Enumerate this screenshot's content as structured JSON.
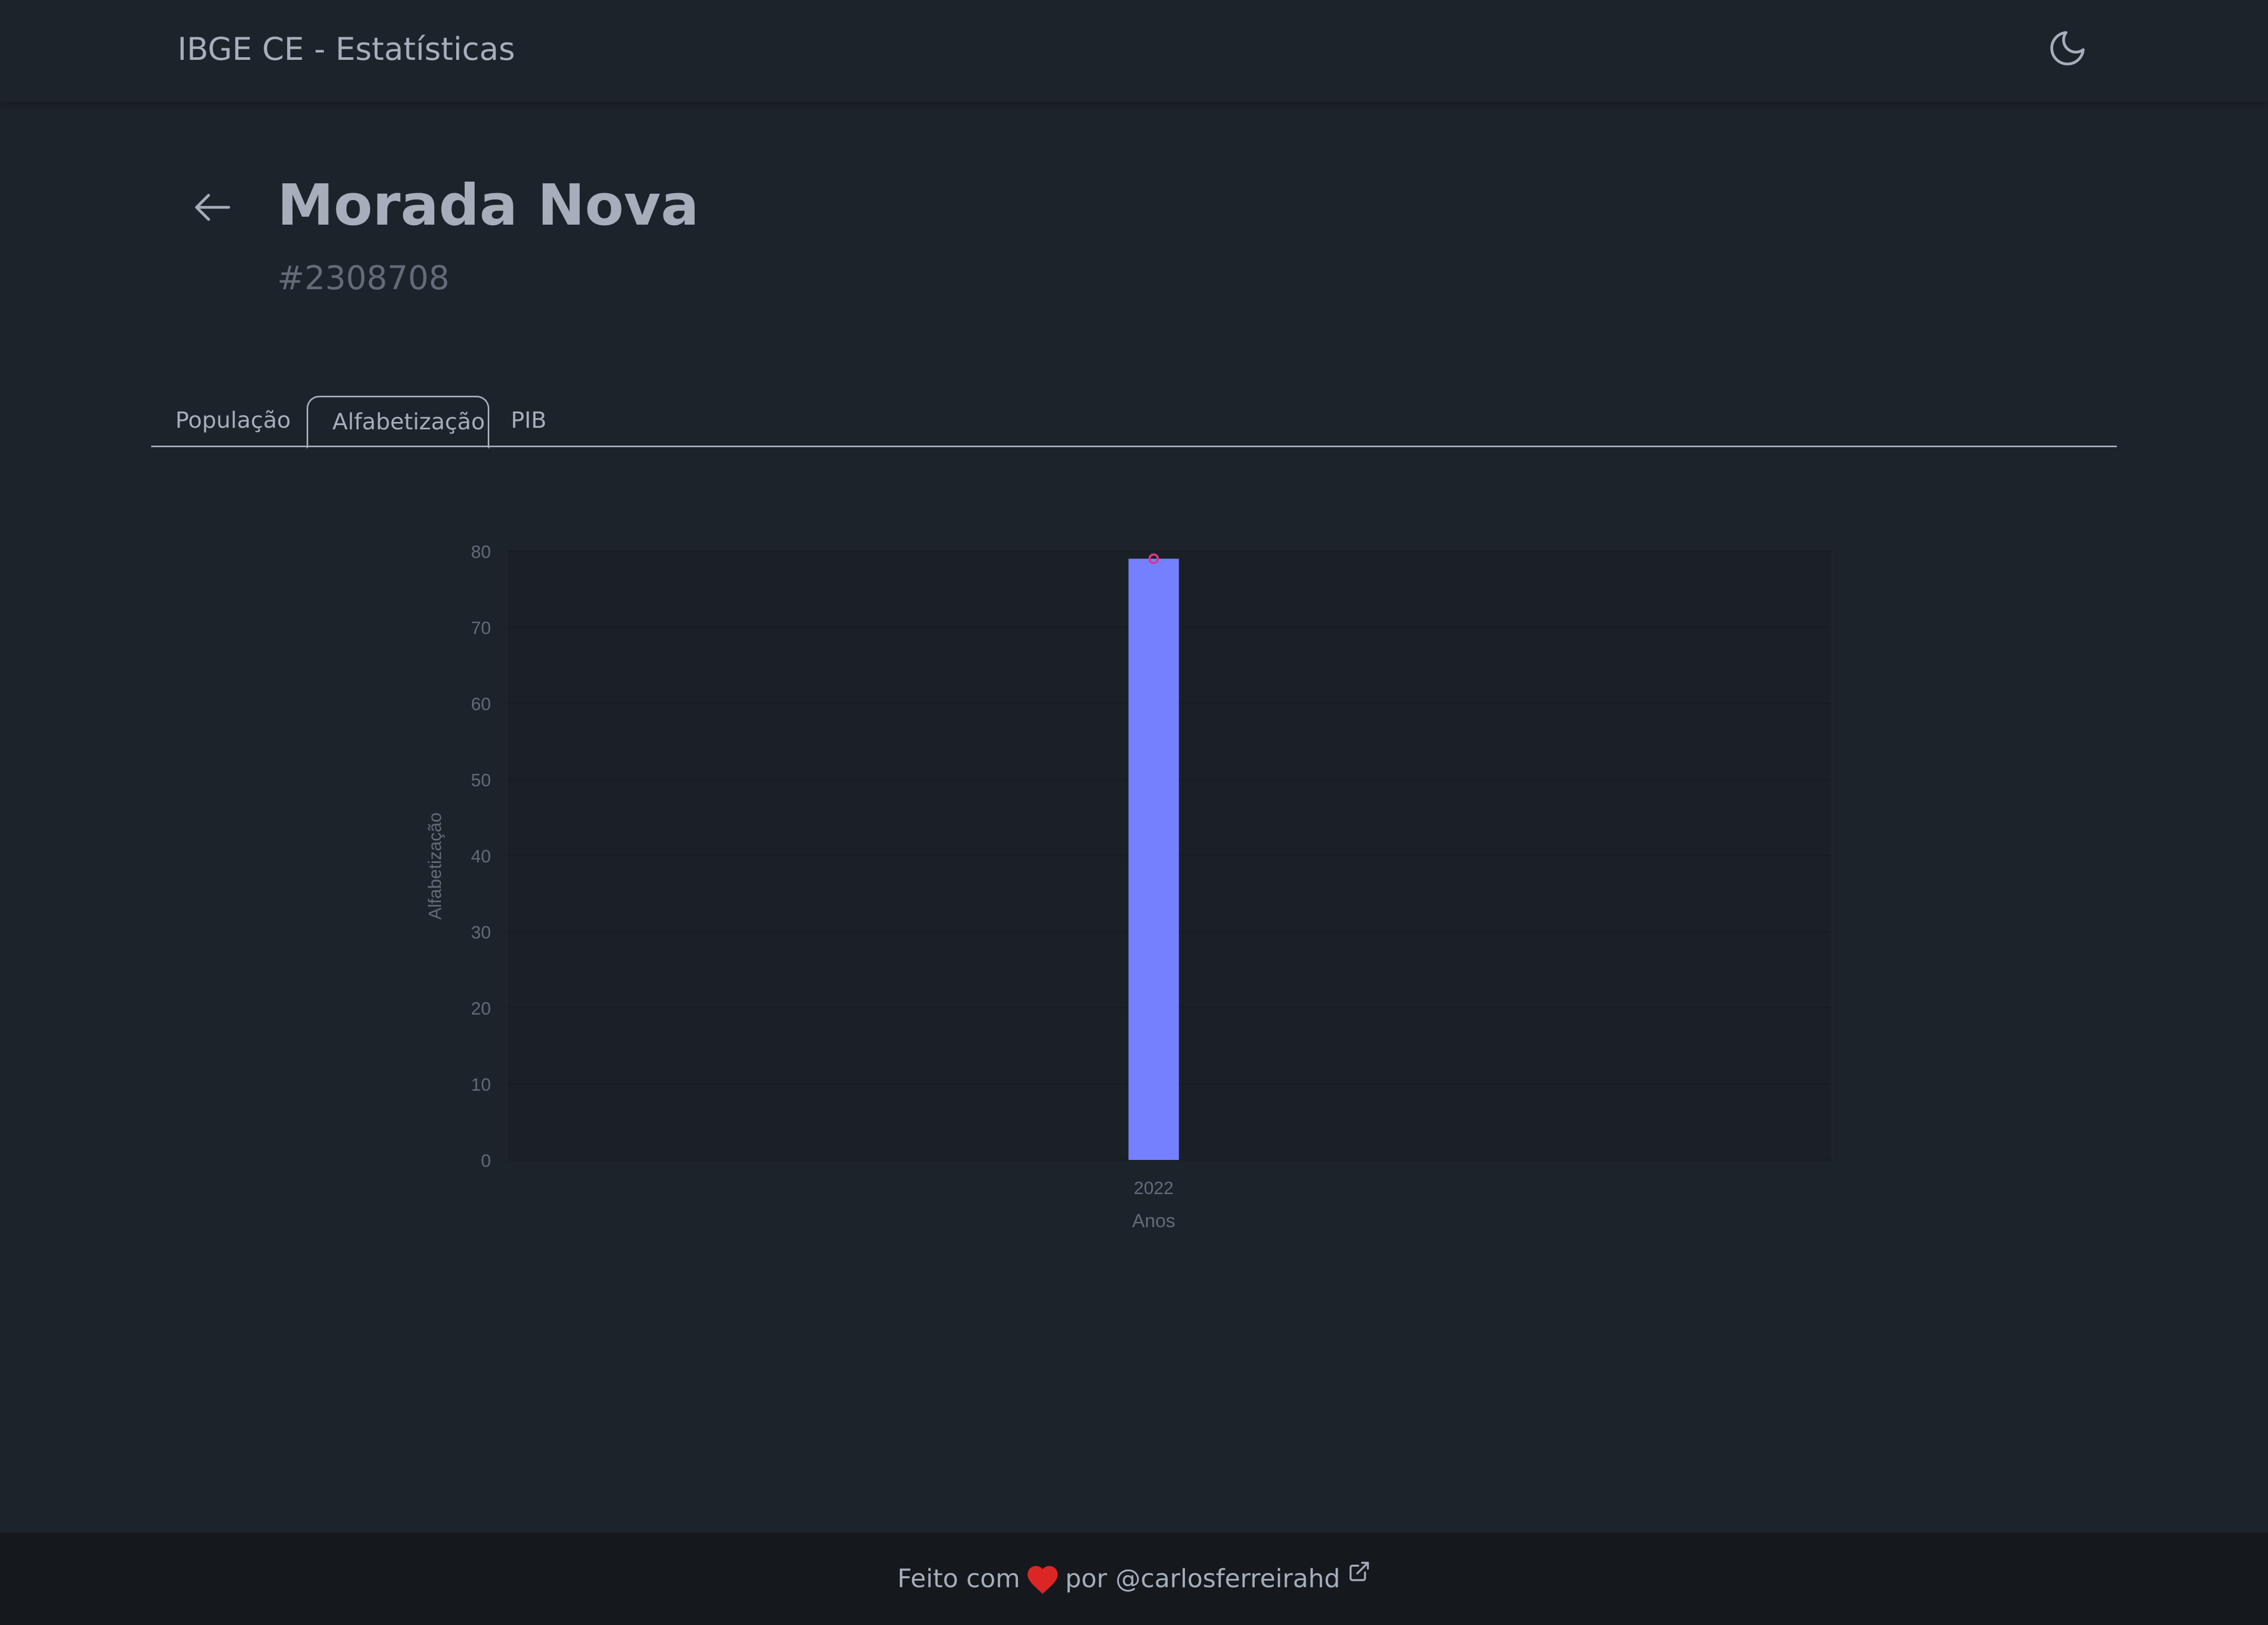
{
  "header": {
    "brand": "IBGE CE - Estatísticas",
    "theme_icon": "moon-icon"
  },
  "city": {
    "name": "Morada Nova",
    "code": "#2308708",
    "back_icon": "arrow-left-icon"
  },
  "tabs": [
    {
      "label": "População",
      "active": false
    },
    {
      "label": "Alfabetização",
      "active": true
    },
    {
      "label": "PIB",
      "active": false
    }
  ],
  "chart_data": {
    "type": "bar",
    "categories": [
      "2022"
    ],
    "values": [
      79
    ],
    "xlabel": "Anos",
    "ylabel": "Alfabetização",
    "ylim": [
      0,
      80
    ],
    "yticks": [
      0,
      10,
      20,
      30,
      40,
      50,
      60,
      70,
      80
    ],
    "bar_color": "#7480ff",
    "marker_color": "#e0338c",
    "grid": true
  },
  "footer": {
    "prefix": "Feito com",
    "middle": "por",
    "author": "@carlosferreirahd",
    "heart_color": "#dc2626"
  }
}
